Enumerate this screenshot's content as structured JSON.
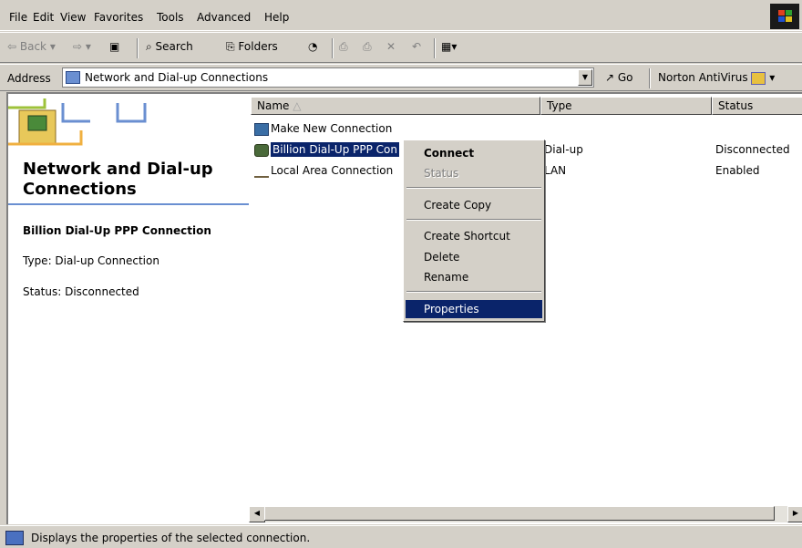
{
  "menubar": {
    "items": [
      "File",
      "Edit",
      "View",
      "Favorites",
      "Tools",
      "Advanced",
      "Help"
    ]
  },
  "toolbar": {
    "back": "Back",
    "search": "Search",
    "folders": "Folders"
  },
  "address": {
    "label": "Address",
    "value": "Network and Dial-up Connections",
    "go": "Go",
    "norton": "Norton AntiVirus"
  },
  "webview": {
    "heading": "Network and Dial-up Connections",
    "selected_name": "Billion Dial-Up PPP Connection",
    "type_line": "Type: Dial-up Connection",
    "status_line": "Status: Disconnected"
  },
  "list": {
    "columns": [
      "Name",
      "Type",
      "Status"
    ],
    "rows": [
      {
        "name": "Make New Connection",
        "type": "",
        "status": "",
        "icon": "new-connection-icon"
      },
      {
        "name": "Billion Dial-Up PPP Con",
        "type": "Dial-up",
        "status": "Disconnected",
        "icon": "dialup-icon"
      },
      {
        "name": "Local Area Connection",
        "type": "LAN",
        "status": "Enabled",
        "icon": "lan-icon"
      }
    ]
  },
  "context_menu": {
    "items": [
      "Connect",
      "Status",
      "Create Copy",
      "Create Shortcut",
      "Delete",
      "Rename",
      "Properties"
    ]
  },
  "statusbar": {
    "text": "Displays the properties of the selected connection."
  },
  "colors": {
    "selection": "#0a246a",
    "chrome": "#d4d0c8",
    "accent_line": "#6a8fd1"
  }
}
